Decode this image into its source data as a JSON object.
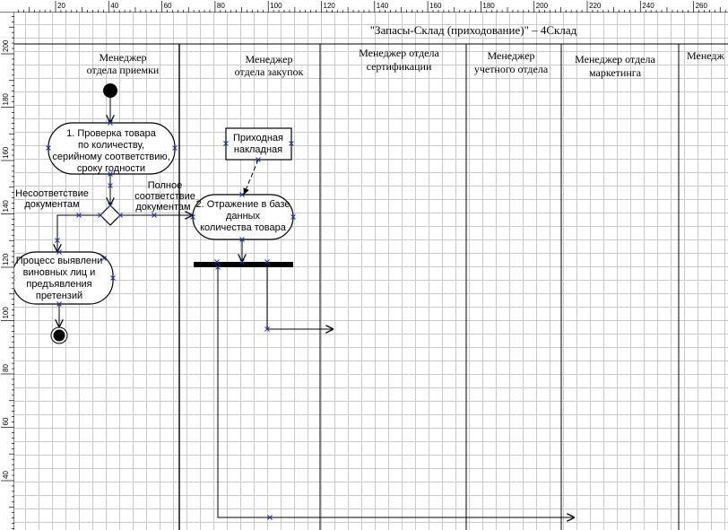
{
  "diagram": {
    "title": "\"Запасы-Склад (приходование)\" – 4Склад",
    "lanes": [
      {
        "line1": "Менеджер",
        "line2": "отдела приемки"
      },
      {
        "line1": "Менеджер",
        "line2": "отдела закупок"
      },
      {
        "line1": "Менеджер отдела",
        "line2": "сертификации"
      },
      {
        "line1": "Менеджер",
        "line2": "учетного отдела"
      },
      {
        "line1": "Менеджер отдела",
        "line2": "маркетинга"
      },
      {
        "line1": "Менедж",
        "line2": ""
      }
    ],
    "activities": {
      "check": {
        "lines": [
          "1. Проверка товара",
          "по количеству,",
          "серийному соответствию,",
          "сроку годности"
        ]
      },
      "record": {
        "lines": [
          "2. Отражение в базе",
          "данных",
          "количества товара"
        ]
      },
      "claims": {
        "lines": [
          "Процесс выявлени",
          "виновных лиц и",
          "предъявления",
          "претензий"
        ]
      }
    },
    "document": {
      "lines": [
        "Приходная",
        "накладная"
      ]
    },
    "flow_labels": {
      "mismatch": [
        "Несоответствие",
        "документам"
      ],
      "match": [
        "Полное",
        "соответствие",
        "документам"
      ]
    }
  },
  "rulers": {
    "top": [
      "20",
      "40",
      "60",
      "80",
      "100",
      "120",
      "140",
      "160",
      "180",
      "200",
      "220",
      "240",
      "260"
    ],
    "left": [
      "200",
      "180",
      "160",
      "140",
      "120",
      "100",
      "80",
      "60",
      "40"
    ]
  }
}
